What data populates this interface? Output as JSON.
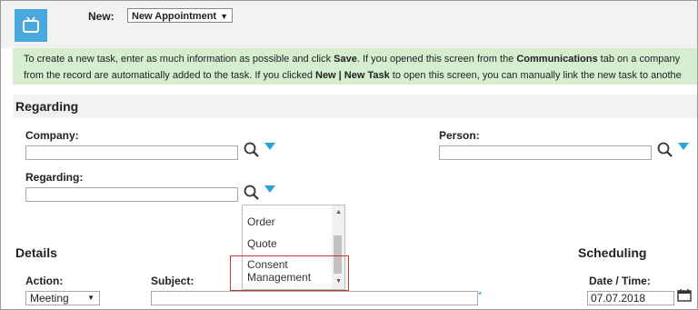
{
  "header": {
    "new_label": "New:",
    "new_select_value": "New Appointment"
  },
  "info": {
    "line1_a": "To create a new task, enter as much information as possible and click ",
    "line1_b": "Save",
    "line1_c": ". If you opened this screen from the ",
    "line1_d": "Communications",
    "line1_e": " tab on a company",
    "line2_a": "from the record are automatically added to the task. If you clicked ",
    "line2_b": "New | New Task",
    "line2_c": " to open this screen, you can manually link the new task to anothe"
  },
  "regarding_section": {
    "title": "Regarding",
    "company_label": "Company:",
    "person_label": "Person:",
    "regarding_label": "Regarding:"
  },
  "dropdown": {
    "items": [
      "Order",
      "Quote",
      "Consent",
      "Management"
    ]
  },
  "details_section": {
    "title": "Details",
    "action_label": "Action:",
    "action_value": "Meeting",
    "subject_label": "Subject:"
  },
  "scheduling": {
    "title": "Scheduling",
    "datetime_label": "Date / Time:",
    "date_value": "07.07.2018"
  },
  "icons": {
    "search": "search-icon",
    "dropdown_arrow": "triangle-down-icon",
    "calendar": "calendar-icon",
    "app": "tv-icon"
  },
  "colors": {
    "accent": "#2aa0dd",
    "app_icon_bg": "#4aa8dc",
    "info_bg": "#d5eed0",
    "highlight": "#c0392b"
  }
}
